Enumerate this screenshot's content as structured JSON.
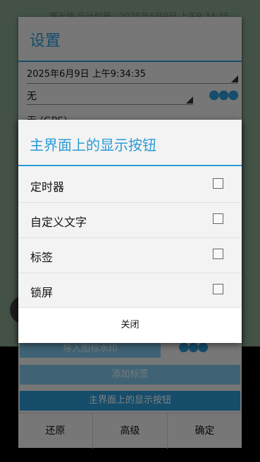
{
  "background": {
    "faint_text": "曝光值·与计时器 · 2025年6月9日 上午9:34:35"
  },
  "settings": {
    "title": "设置",
    "datetime_value": "2025年6月9日 上午9:34:35",
    "location_value": "无",
    "gps_value": "无 (GPS)",
    "import_watermark_label": "导入图标水印",
    "add_label_label": "添加标签",
    "main_buttons_label": "主界面上的显示按钮",
    "bottom_buttons": [
      "还原",
      "高级",
      "确定"
    ]
  },
  "dialog": {
    "title": "主界面上的显示按钮",
    "options": [
      {
        "label": "定时器",
        "checked": false
      },
      {
        "label": "自定义文字",
        "checked": false
      },
      {
        "label": "标签",
        "checked": false
      },
      {
        "label": "锁屏",
        "checked": false
      }
    ],
    "close_label": "关闭"
  },
  "colors": {
    "accent": "#2a9bd7",
    "background_app": "#86a38d"
  },
  "icons": {
    "more": "more-dots-icon",
    "dropdown": "dropdown-arrow-icon"
  }
}
